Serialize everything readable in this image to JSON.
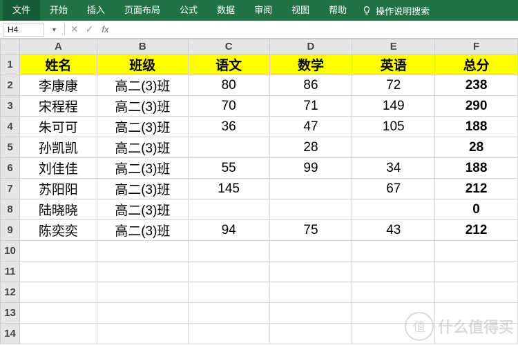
{
  "ribbon": {
    "file": "文件",
    "tabs": [
      "开始",
      "插入",
      "页面布局",
      "公式",
      "数据",
      "审阅",
      "视图",
      "帮助"
    ],
    "hint_icon": "bulb-icon",
    "hint": "操作说明搜索"
  },
  "formula_bar": {
    "namebox": "H4",
    "dropdown_glyph": "▼",
    "cancel_glyph": "✕",
    "confirm_glyph": "✓",
    "fx_label": "fx",
    "formula": ""
  },
  "grid": {
    "columns": [
      "A",
      "B",
      "C",
      "D",
      "E",
      "F"
    ],
    "row_count": 14,
    "selected_cell": "H4",
    "header_row": 1,
    "headers": [
      "姓名",
      "班级",
      "语文",
      "数学",
      "英语",
      "总分"
    ],
    "rows": [
      {
        "r": 2,
        "name": "李康康",
        "class": "高二(3)班",
        "c": "80",
        "d": "86",
        "e": "72",
        "total": "238"
      },
      {
        "r": 3,
        "name": "宋程程",
        "class": "高二(3)班",
        "c": "70",
        "d": "71",
        "e": "149",
        "total": "290"
      },
      {
        "r": 4,
        "name": "朱可可",
        "class": "高二(3)班",
        "c": "36",
        "d": "47",
        "e": "105",
        "total": "188"
      },
      {
        "r": 5,
        "name": "孙凯凯",
        "class": "高二(3)班",
        "c": "",
        "d": "28",
        "e": "",
        "total": "28"
      },
      {
        "r": 6,
        "name": "刘佳佳",
        "class": "高二(3)班",
        "c": "55",
        "d": "99",
        "e": "34",
        "total": "188"
      },
      {
        "r": 7,
        "name": "苏阳阳",
        "class": "高二(3)班",
        "c": "145",
        "d": "",
        "e": "67",
        "total": "212"
      },
      {
        "r": 8,
        "name": "陆晓晓",
        "class": "高二(3)班",
        "c": "",
        "d": "",
        "e": "",
        "total": "0"
      },
      {
        "r": 9,
        "name": "陈奕奕",
        "class": "高二(3)班",
        "c": "94",
        "d": "75",
        "e": "43",
        "total": "212"
      }
    ]
  },
  "watermark": {
    "circle": "值",
    "text": "什么值得买"
  }
}
